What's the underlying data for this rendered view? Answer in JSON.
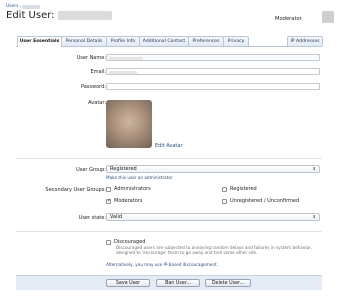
{
  "breadcrumb": {
    "root": "Users",
    "separator": "›"
  },
  "header": {
    "title": "Edit User:",
    "role": "Moderator"
  },
  "tabs": [
    {
      "label": "User Essentials"
    },
    {
      "label": "Personal Details"
    },
    {
      "label": "Profile Info"
    },
    {
      "label": "Additional Contact"
    },
    {
      "label": "Preferences"
    },
    {
      "label": "Privacy"
    },
    {
      "label": "IP Addresses"
    }
  ],
  "form": {
    "username_label": "User Name:",
    "email_label": "Email:",
    "password_label": "Password:",
    "avatar_label": "Avatar:",
    "edit_avatar": "Edit Avatar",
    "user_group_label": "User Group:",
    "user_group_value": "Registered",
    "make_admin": "Make this user an administrator",
    "secondary_label": "Secondary User Groups:",
    "secondary_groups": [
      {
        "label": "Administrators",
        "checked": false,
        "mark": ""
      },
      {
        "label": "Moderators",
        "checked": true,
        "mark": "✓"
      },
      {
        "label": "Registered",
        "checked": false,
        "mark": ""
      },
      {
        "label": "Unregistered / Unconfirmed",
        "checked": false,
        "mark": ""
      }
    ],
    "user_state_label": "User state:",
    "user_state_value": "Valid",
    "discouraged_label": "Discouraged",
    "discouraged_desc": "Discouraged users are subjected to annoying random delays and failures in system behavior, designed to 'encourage' them to go away and troll some other site.",
    "ip_discouragement": "Alternatively, you may use IP-based discouragement."
  },
  "buttons": {
    "save": "Save User",
    "ban": "Ban User...",
    "delete": "Delete User..."
  },
  "icons": {
    "caret": "⬍"
  }
}
